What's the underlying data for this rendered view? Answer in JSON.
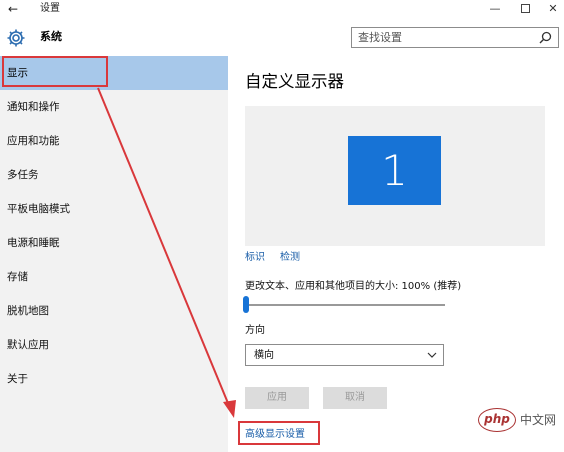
{
  "window": {
    "back_glyph": "←",
    "title": "设置",
    "minimize_glyph": "—",
    "close_glyph": "✕"
  },
  "header": {
    "icon": "gear-icon",
    "title": "系统",
    "search_placeholder": "查找设置"
  },
  "sidebar": {
    "items": [
      {
        "label": "显示",
        "active": true
      },
      {
        "label": "通知和操作"
      },
      {
        "label": "应用和功能"
      },
      {
        "label": "多任务"
      },
      {
        "label": "平板电脑模式"
      },
      {
        "label": "电源和睡眠"
      },
      {
        "label": "存储"
      },
      {
        "label": "脱机地图"
      },
      {
        "label": "默认应用"
      },
      {
        "label": "关于"
      }
    ]
  },
  "main": {
    "title": "自定义显示器",
    "monitor_number": "1",
    "identify_link": "标识",
    "detect_link": "检测",
    "scale_label": "更改文本、应用和其他项目的大小: 100% (推荐)",
    "scale_value_percent": 100,
    "slider_fraction": 0.0,
    "orientation_label": "方向",
    "orientation_value": "横向",
    "apply_button": "应用",
    "cancel_button": "取消",
    "advanced_link": "高级显示设置"
  },
  "colors": {
    "accent": "#1773d6",
    "selected_nav": "#a7c8ea",
    "annotation_red": "#d9383b",
    "link": "#1a5ea8"
  },
  "watermark": {
    "logo_text": "php",
    "text": "中文网"
  }
}
